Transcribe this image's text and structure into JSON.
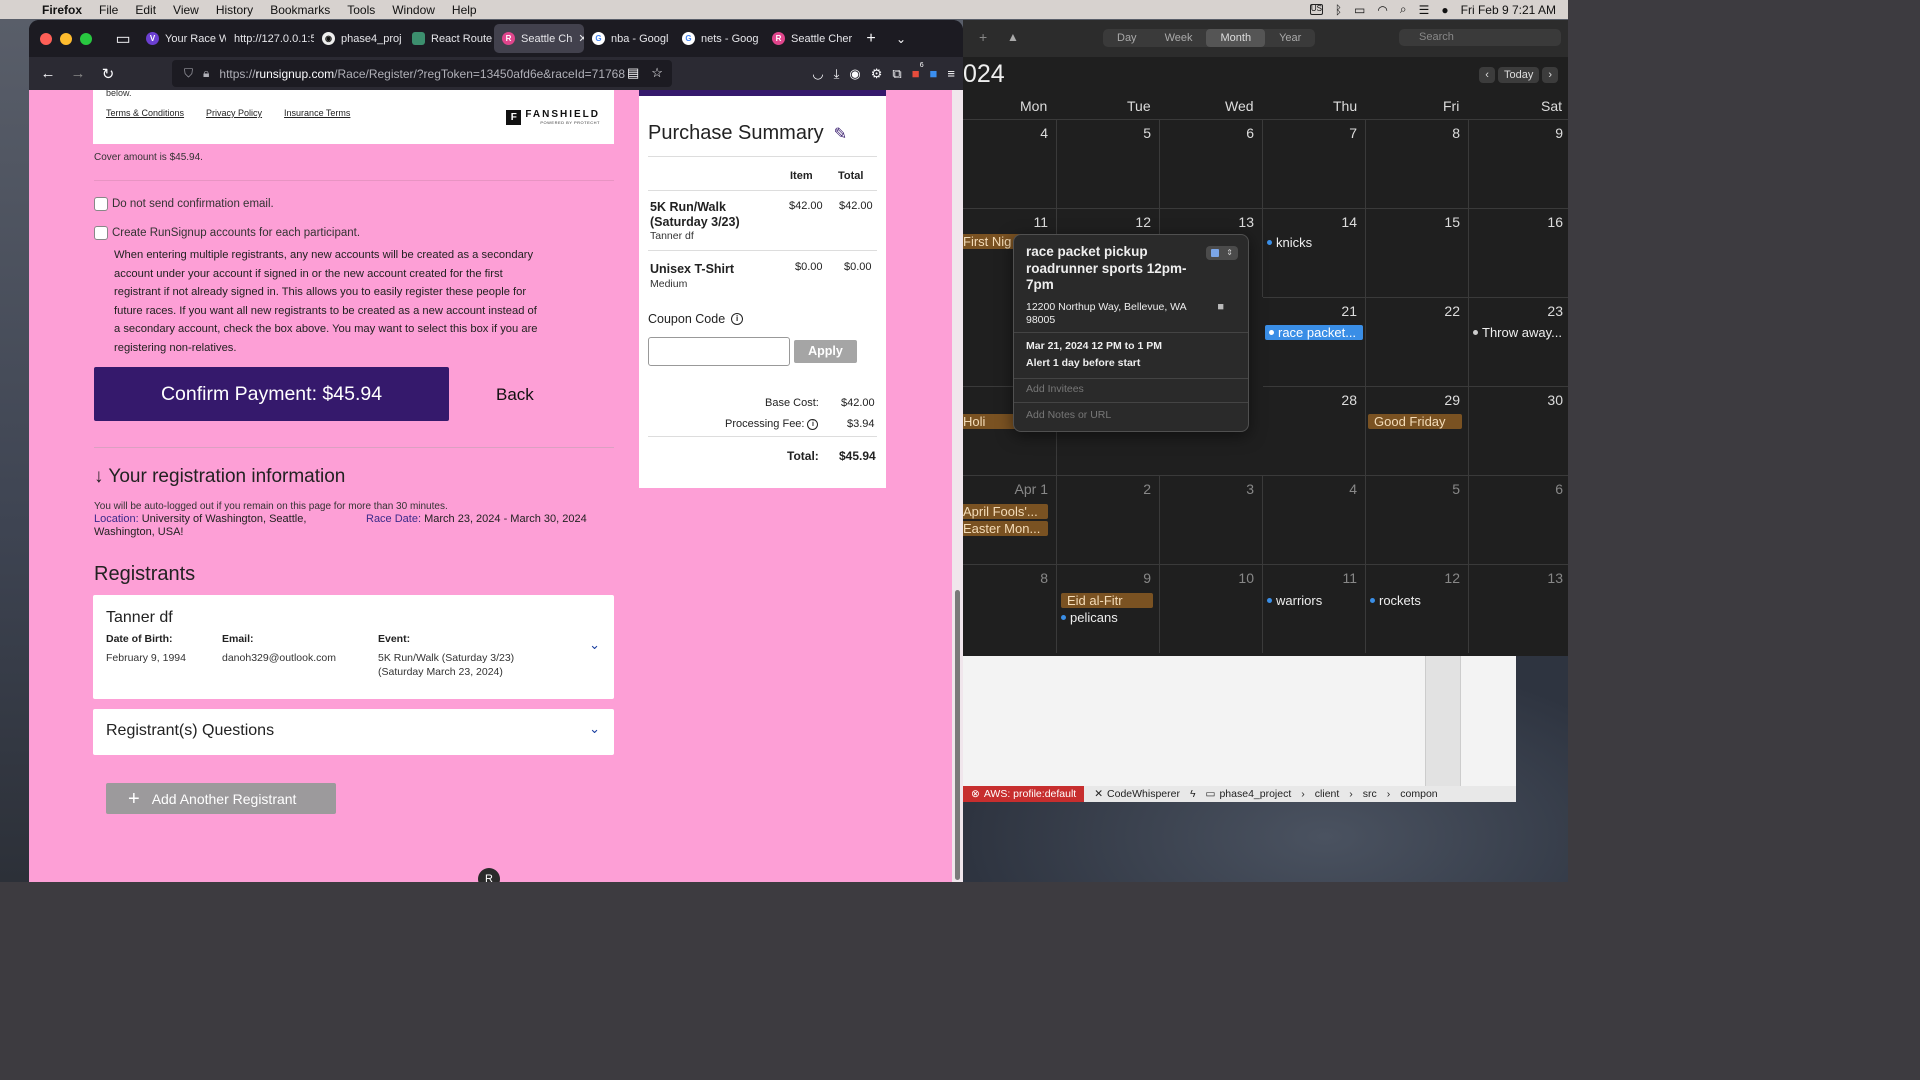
{
  "menubar": {
    "app": "Firefox",
    "items": [
      "File",
      "Edit",
      "View",
      "History",
      "Bookmarks",
      "Tools",
      "Window",
      "Help"
    ],
    "input_source": "US",
    "datetime": "Fri Feb 9  7:21 AM"
  },
  "browser": {
    "tabs": [
      {
        "label": "Your Race W",
        "color": "#6b3fd1",
        "glyph": "V"
      },
      {
        "label": "http://127.0.0.1:5",
        "color": "",
        "glyph": ""
      },
      {
        "label": "phase4_proj",
        "color": "#eee",
        "glyph": "◉"
      },
      {
        "label": "React Route",
        "color": "#3c8f6e",
        "glyph": "◘"
      },
      {
        "label": "Seattle Ch",
        "color": "#e0458c",
        "glyph": "R"
      },
      {
        "label": "nba - Googl",
        "color": "#ffffff",
        "glyph": "G"
      },
      {
        "label": "nets - Goog",
        "color": "#ffffff",
        "glyph": "G"
      },
      {
        "label": "Seattle Cher",
        "color": "#e0458c",
        "glyph": "R"
      }
    ],
    "url_prefix": "https://",
    "url_domain": "runsignup.com",
    "url_rest": "/Race/Register/?regToken=13450afd6e&raceId=71768",
    "badge_count": "6"
  },
  "page": {
    "below_text": "below.",
    "links": [
      "Terms & Conditions",
      "Privacy Policy",
      "Insurance Terms"
    ],
    "fanshield": {
      "name": "FANSHIELD",
      "tagline": "POWERED BY PROTECHT"
    },
    "cover_amount": "Cover amount is $45.94.",
    "checkbox1": "Do not send confirmation email.",
    "checkbox2": "Create RunSignup accounts for each participant.",
    "explanation": "When entering multiple registrants, any new accounts will be created as a secondary account under your account if signed in or the new account created for the first registrant if not already signed in. This allows you to easily register these people for future races. If you want all new registrants to be created as a new account instead of a secondary account, check the box above. You may want to select this box if you are registering non-relatives.",
    "confirm_button": "Confirm Payment: $45.94",
    "back_button": "Back",
    "reg_info_heading": "↓ Your registration information",
    "autologout": "You will be auto-logged out if you remain on this page for more than 30 minutes.",
    "location_label": "Location:",
    "location_value": "University of Washington, Seattle, Washington, USA!",
    "race_date_label": "Race Date:",
    "race_date_value": "March 23, 2024 - March 30, 2024",
    "registrants_heading": "Registrants",
    "registrant": {
      "name": "Tanner df",
      "dob_label": "Date of Birth:",
      "dob": "February 9, 1994",
      "email_label": "Email:",
      "email": "danoh329@outlook.com",
      "event_label": "Event:",
      "event_line1": "5K Run/Walk (Saturday 3/23)",
      "event_line2": "(Saturday March 23, 2024)"
    },
    "questions_heading": "Registrant(s) Questions",
    "add_registrant": "Add Another Registrant",
    "logo_glyph": "R"
  },
  "summary": {
    "title": "Purchase Summary",
    "col_item": "Item",
    "col_total": "Total",
    "items": [
      {
        "name": "5K Run/Walk (Saturday 3/23)",
        "sub": "Tanner df",
        "item": "$42.00",
        "total": "$42.00"
      },
      {
        "name": "Unisex T-Shirt",
        "sub": "Medium",
        "item": "$0.00",
        "total": "$0.00"
      }
    ],
    "coupon_label": "Coupon Code",
    "apply": "Apply",
    "base_cost_label": "Base Cost:",
    "base_cost": "$42.00",
    "fee_label": "Processing Fee:",
    "fee": "$3.94",
    "total_label": "Total:",
    "total": "$45.94"
  },
  "calendar": {
    "views": [
      "Day",
      "Week",
      "Month",
      "Year"
    ],
    "active_view": "Month",
    "search_placeholder": "Search",
    "year_fragment": "024",
    "today": "Today",
    "weekdays": [
      "Mon",
      "Tue",
      "Wed",
      "Thu",
      "Fri",
      "Sat"
    ],
    "weeks": [
      {
        "days": [
          "4",
          "5",
          "6",
          "7",
          "8",
          "9"
        ]
      },
      {
        "days": [
          "11",
          "12",
          "13",
          "14",
          "15",
          "16"
        ]
      },
      {
        "days": [
          "",
          "",
          "",
          "21",
          "22",
          "23"
        ]
      },
      {
        "days": [
          "",
          "",
          "",
          "28",
          "29",
          "30"
        ]
      },
      {
        "days": [
          "Apr 1",
          "2",
          "3",
          "4",
          "5",
          "6"
        ]
      },
      {
        "days": [
          "8",
          "9",
          "10",
          "11",
          "12",
          "13"
        ]
      }
    ],
    "events": {
      "first_night": "First Nig",
      "knicks": "knicks",
      "race_packet": "race packet...",
      "throw_away": "Throw away...",
      "holi": "Holi",
      "good_friday": "Good Friday",
      "april_fools": "April Fools'...",
      "easter_monday": "Easter Mon...",
      "eid": "Eid al-Fitr",
      "pelicans": "pelicans",
      "warriors": "warriors",
      "rockets": "rockets"
    },
    "popup": {
      "title": "race packet pickup roadrunner sports 12pm-7pm",
      "location": "12200 Northup Way, Bellevue, WA 98005",
      "date": "Mar 21, 2024  12 PM to 1 PM",
      "alert": "Alert 1 day before start",
      "invitees_placeholder": "Add Invitees",
      "notes_placeholder": "Add Notes or URL"
    }
  },
  "vscode_status": {
    "aws": "AWS: profile:default",
    "codewhisperer": "CodeWhisperer",
    "crumbs": [
      "phase4_project",
      "client",
      "src",
      "compon"
    ]
  }
}
